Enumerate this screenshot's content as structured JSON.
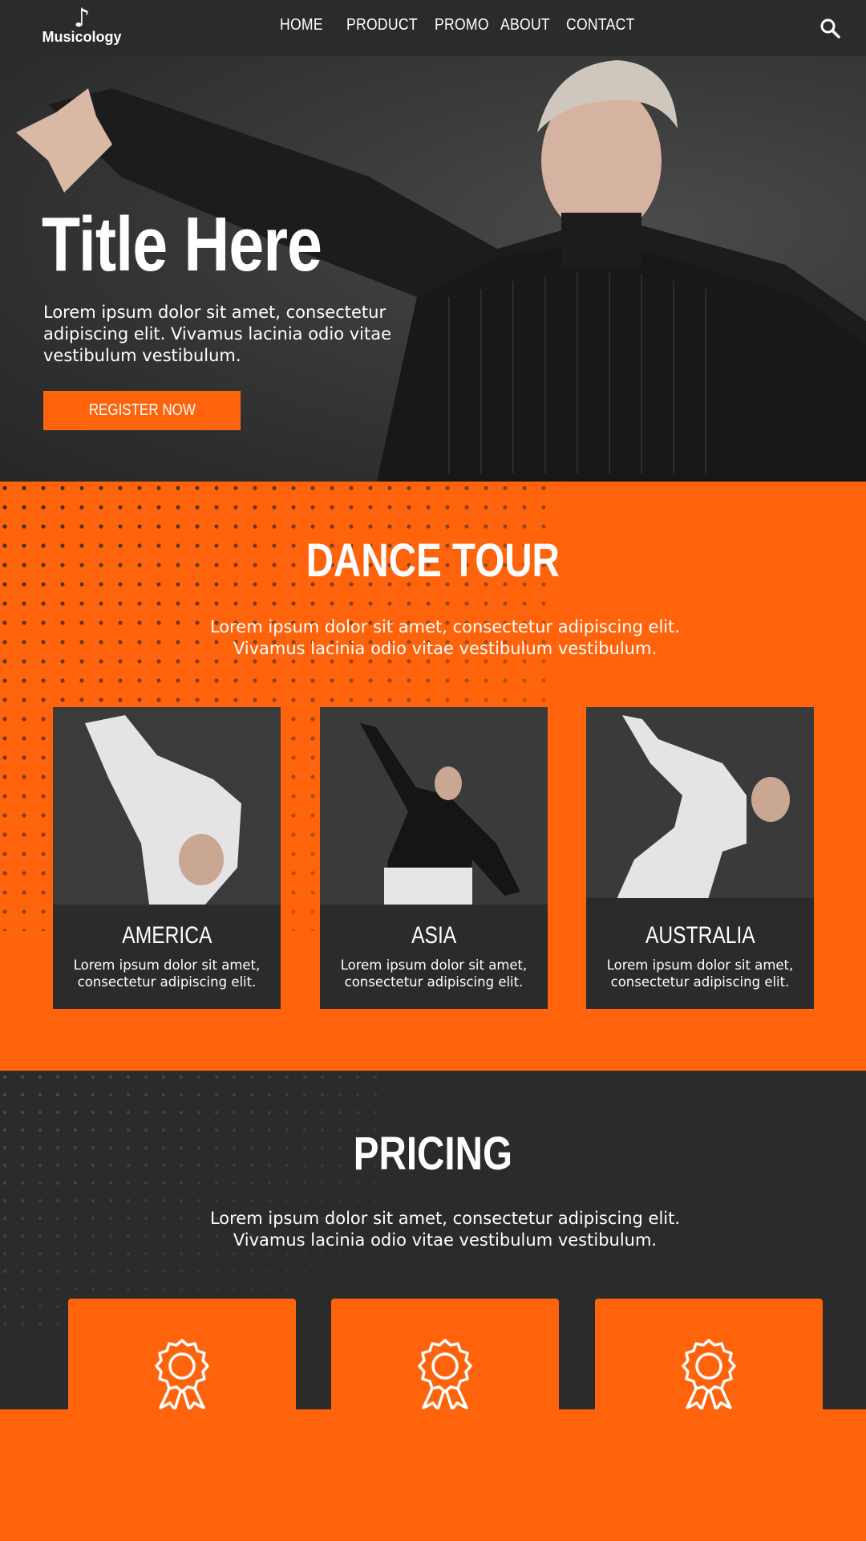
{
  "brand": {
    "name": "Musicology",
    "icon": "music-note-icon"
  },
  "nav": {
    "items": [
      {
        "label": "HOME"
      },
      {
        "label": "PRODUCT"
      },
      {
        "label": "PROMO"
      },
      {
        "label": "ABOUT"
      },
      {
        "label": "CONTACT"
      }
    ],
    "search_icon": "search-icon"
  },
  "hero": {
    "title": "Title Here",
    "text": "Lorem ipsum dolor sit amet, consectetur adipiscing elit. Vivamus lacinia odio vitae vestibulum vestibulum.",
    "button_label": "REGISTER NOW"
  },
  "tour": {
    "title": "DANCE TOUR",
    "text_line1": "Lorem ipsum dolor sit amet, consectetur adipiscing elit.",
    "text_line2": "Vivamus lacinia odio vitae vestibulum vestibulum.",
    "cards": [
      {
        "name": "AMERICA",
        "text": "Lorem ipsum dolor sit amet, consectetur adipiscing elit."
      },
      {
        "name": "ASIA",
        "text": "Lorem ipsum dolor sit amet, consectetur adipiscing elit."
      },
      {
        "name": "AUSTRALIA",
        "text": "Lorem ipsum dolor sit amet, consectetur adipiscing elit."
      }
    ]
  },
  "pricing": {
    "title": "PRICING",
    "text_line1": "Lorem ipsum dolor sit amet, consectetur adipiscing elit.",
    "text_line2": "Vivamus lacinia odio vitae vestibulum vestibulum.",
    "card_icon": "award-badge-icon"
  },
  "colors": {
    "accent": "#ff640d",
    "dark": "#2b2b2b",
    "text": "#ffffff"
  }
}
